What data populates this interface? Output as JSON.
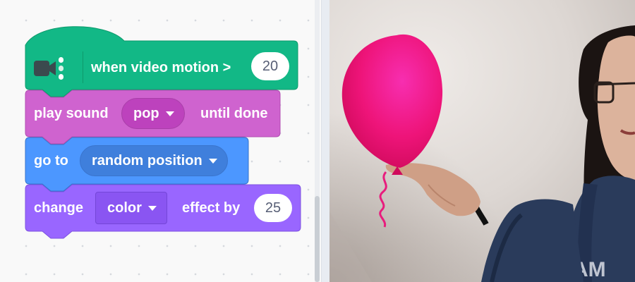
{
  "blocks": {
    "hat": {
      "label": "when video motion >",
      "value": "20",
      "icon": "video-sensing-icon",
      "color": "#12b886"
    },
    "play_sound": {
      "label_before": "play sound",
      "dropdown": "pop",
      "label_after": "until done",
      "color": "#cf63cf"
    },
    "go_to": {
      "label": "go to",
      "dropdown": "random position",
      "color": "#4c97ff"
    },
    "change_effect": {
      "label_before": "change",
      "dropdown": "color",
      "label_after": "effect by",
      "value": "25",
      "color": "#9966ff"
    }
  },
  "stage": {
    "scene": "video feed with pink balloon sprite",
    "balloon_color": "#f0197d"
  }
}
